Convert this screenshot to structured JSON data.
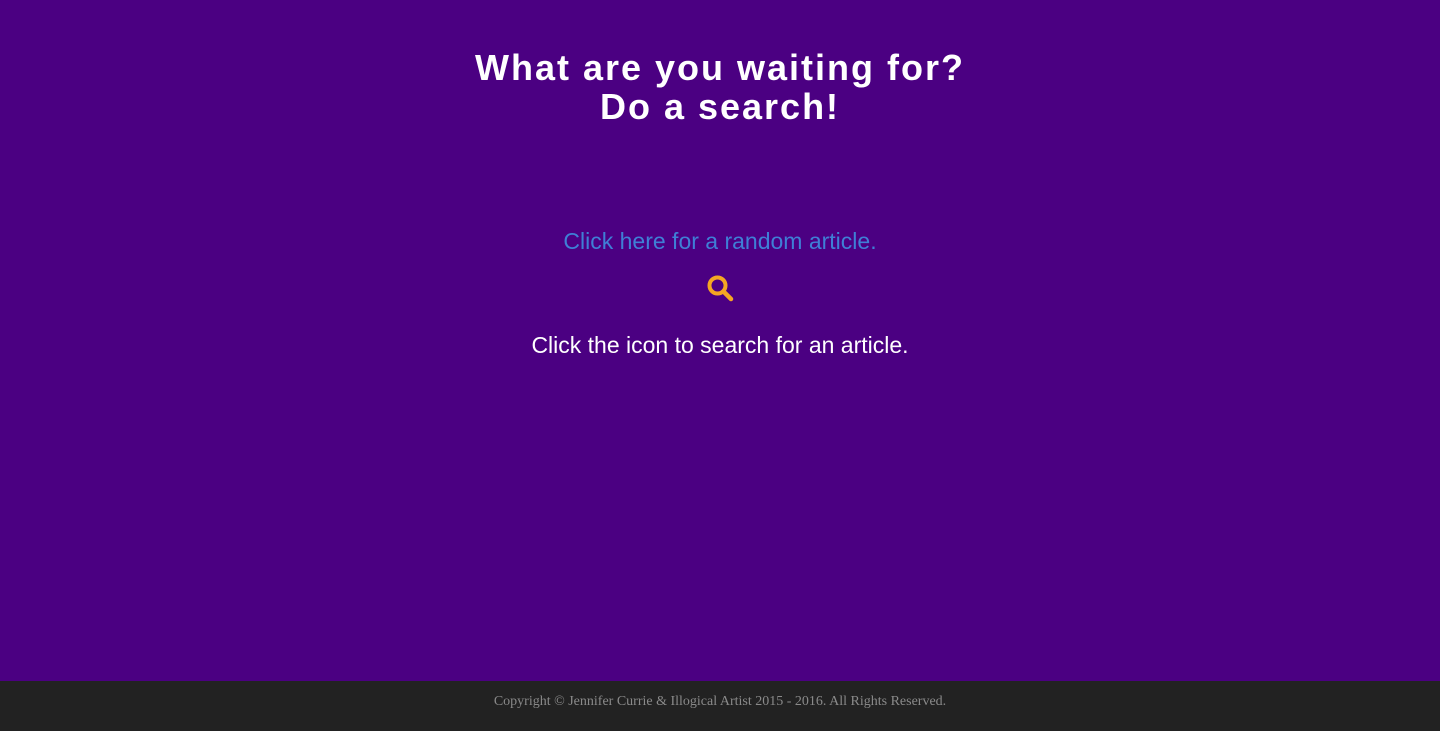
{
  "colors": {
    "background": "#4b0082",
    "heading": "#ffffff",
    "link": "#3f7fd6",
    "icon": "#f5a623",
    "footer_bg": "#222222",
    "footer_text": "#8a8a8a"
  },
  "heading": {
    "line1": "What are you waiting for?",
    "line2": "Do a search!"
  },
  "random_link": {
    "label": "Click here for a random article."
  },
  "search": {
    "icon": "search-icon",
    "hint": "Click the icon to search for an article."
  },
  "footer": {
    "copyright": "Copyright © Jennifer Currie & Illogical Artist 2015 - 2016. All Rights Reserved."
  }
}
